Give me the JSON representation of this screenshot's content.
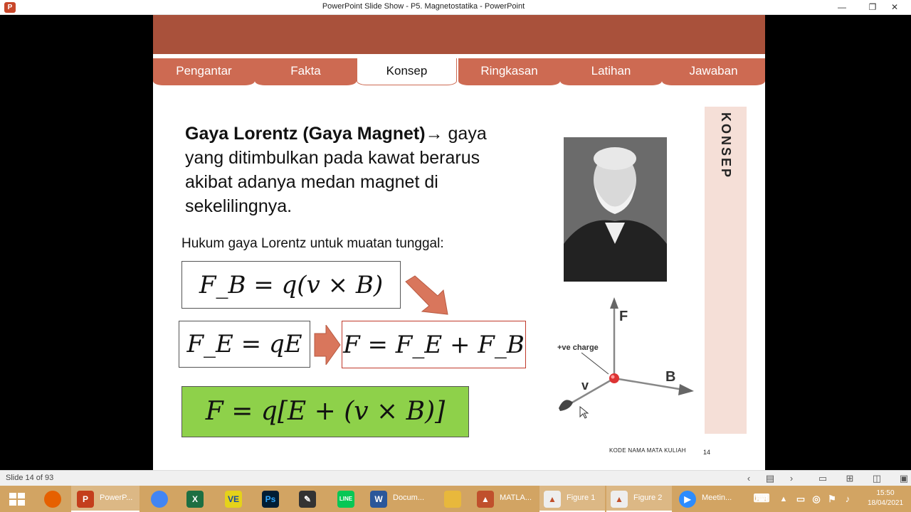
{
  "window": {
    "title": "PowerPoint Slide Show  -  P5. Magnetostatika - PowerPoint",
    "app_icon_letter": "P",
    "minimize": "—",
    "restore": "❐",
    "close": "✕"
  },
  "nav": {
    "tabs": [
      {
        "label": "Pengantar"
      },
      {
        "label": "Fakta"
      },
      {
        "label": "Konsep"
      },
      {
        "label": "Ringkasan"
      },
      {
        "label": "Latihan"
      },
      {
        "label": "Jawaban"
      }
    ],
    "active": "Konsep"
  },
  "slide": {
    "heading_bold": "Gaya Lorentz (Gaya Magnet)",
    "heading_arrow": "→",
    "heading_rest": "gaya yang ditimbulkan pada kawat berarus akibat adanya medan magnet di sekelilingnya.",
    "subheading": "Hukum gaya Lorentz untuk muatan tunggal:",
    "eq1": "F_B = q(v × B)",
    "eq2": "F_E = qE",
    "eq3": "F = F_E + F_B",
    "eq4": "F = q[E + (v × B)]",
    "side_label": "KONSEP",
    "diagram": {
      "label_f": "F",
      "label_b": "B",
      "label_v": "v",
      "label_charge": "+ve charge"
    },
    "footer_code": "KODE NAMA MATA KULIAH",
    "footer_number": "14"
  },
  "statusbar": {
    "slide_info": "Slide 14 of 93"
  },
  "taskbar": {
    "items": [
      {
        "label": "PowerP..."
      },
      {
        "label": "Docum..."
      },
      {
        "label": "MATLA..."
      },
      {
        "label": "Figure 1"
      },
      {
        "label": "Figure 2"
      },
      {
        "label": "Meetin..."
      }
    ],
    "time": "15:50",
    "date": "18/04/2021"
  },
  "colors": {
    "header": "#a9513b",
    "tab": "#cd6a52",
    "green_box": "#8ed14a",
    "arrow": "#d9765c",
    "taskbar": "#d2a463"
  }
}
